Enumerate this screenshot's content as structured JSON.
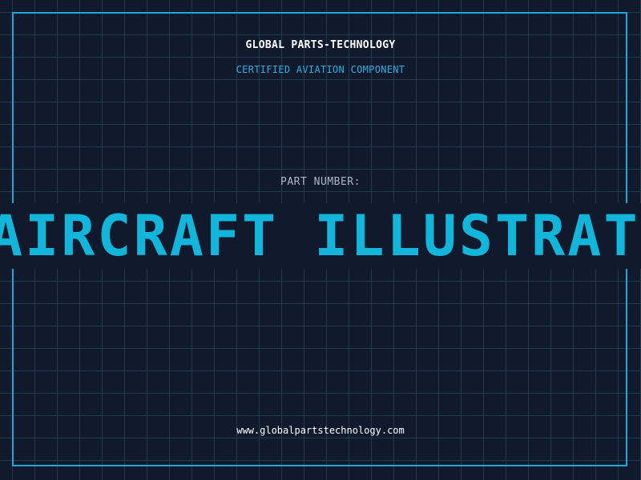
{
  "label": {
    "company_name": "GLOBAL PARTS-TECHNOLOGY",
    "certification": "CERTIFIED AVIATION COMPONENT",
    "part_number_label": "PART NUMBER:",
    "part_number_value": "AIRCRAFT ILLUSTRATED",
    "website": "www.globalpartstechnology.com"
  },
  "colors": {
    "background": "#111a2d",
    "grid": "#1e3a52",
    "frame": "#1fa8d6",
    "accent": "#12b6db"
  }
}
